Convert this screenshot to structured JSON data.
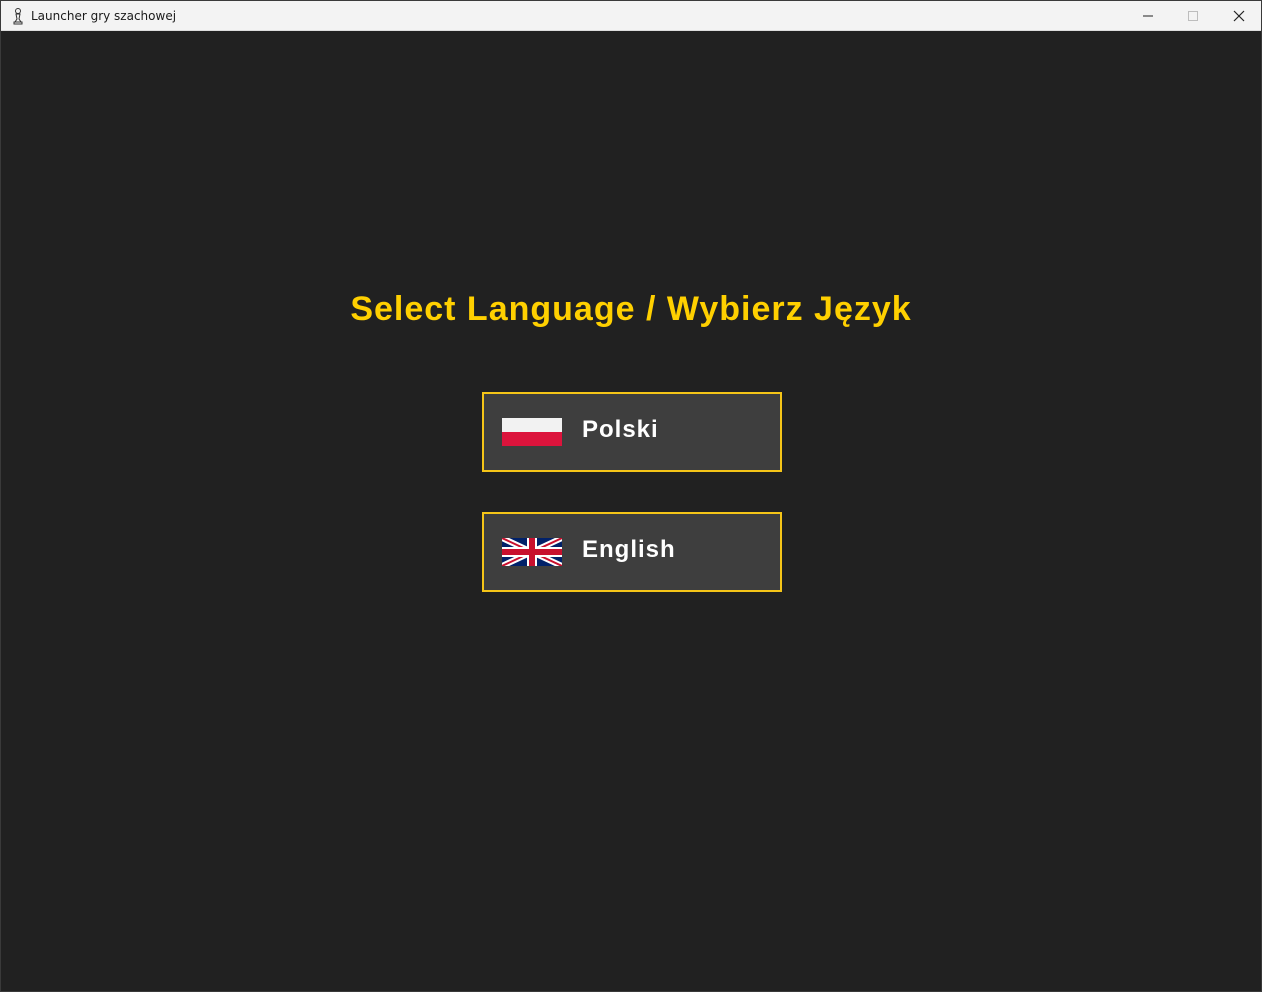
{
  "window": {
    "title": "Launcher gry szachowej",
    "icons": {
      "app": "chess-pawn-icon",
      "minimize": "minimize-icon",
      "maximize": "maximize-icon",
      "close": "close-icon"
    }
  },
  "main": {
    "heading": "Select Language / Wybierz Język",
    "buttons": [
      {
        "label": "Polski",
        "flag": "poland-flag-icon"
      },
      {
        "label": "English",
        "flag": "uk-flag-icon"
      }
    ]
  },
  "colors": {
    "background": "#212121",
    "heading": "#ffd000",
    "button_bg": "#3e3e3e",
    "button_border": "#f5c518",
    "button_text": "#ffffff"
  }
}
